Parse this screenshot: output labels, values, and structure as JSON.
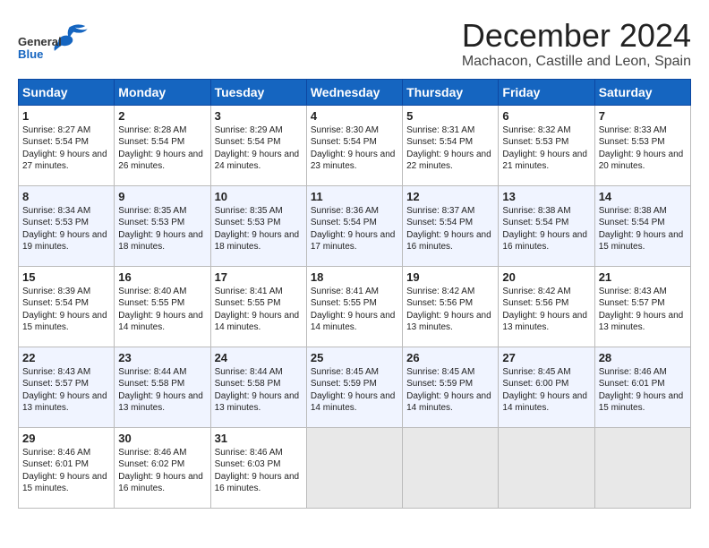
{
  "header": {
    "logo_general": "General",
    "logo_blue": "Blue",
    "month_title": "December 2024",
    "location": "Machacon, Castille and Leon, Spain"
  },
  "weekdays": [
    "Sunday",
    "Monday",
    "Tuesday",
    "Wednesday",
    "Thursday",
    "Friday",
    "Saturday"
  ],
  "weeks": [
    [
      {
        "day": "1",
        "sunrise": "Sunrise: 8:27 AM",
        "sunset": "Sunset: 5:54 PM",
        "daylight": "Daylight: 9 hours and 27 minutes."
      },
      {
        "day": "2",
        "sunrise": "Sunrise: 8:28 AM",
        "sunset": "Sunset: 5:54 PM",
        "daylight": "Daylight: 9 hours and 26 minutes."
      },
      {
        "day": "3",
        "sunrise": "Sunrise: 8:29 AM",
        "sunset": "Sunset: 5:54 PM",
        "daylight": "Daylight: 9 hours and 24 minutes."
      },
      {
        "day": "4",
        "sunrise": "Sunrise: 8:30 AM",
        "sunset": "Sunset: 5:54 PM",
        "daylight": "Daylight: 9 hours and 23 minutes."
      },
      {
        "day": "5",
        "sunrise": "Sunrise: 8:31 AM",
        "sunset": "Sunset: 5:54 PM",
        "daylight": "Daylight: 9 hours and 22 minutes."
      },
      {
        "day": "6",
        "sunrise": "Sunrise: 8:32 AM",
        "sunset": "Sunset: 5:53 PM",
        "daylight": "Daylight: 9 hours and 21 minutes."
      },
      {
        "day": "7",
        "sunrise": "Sunrise: 8:33 AM",
        "sunset": "Sunset: 5:53 PM",
        "daylight": "Daylight: 9 hours and 20 minutes."
      }
    ],
    [
      {
        "day": "8",
        "sunrise": "Sunrise: 8:34 AM",
        "sunset": "Sunset: 5:53 PM",
        "daylight": "Daylight: 9 hours and 19 minutes."
      },
      {
        "day": "9",
        "sunrise": "Sunrise: 8:35 AM",
        "sunset": "Sunset: 5:53 PM",
        "daylight": "Daylight: 9 hours and 18 minutes."
      },
      {
        "day": "10",
        "sunrise": "Sunrise: 8:35 AM",
        "sunset": "Sunset: 5:53 PM",
        "daylight": "Daylight: 9 hours and 18 minutes."
      },
      {
        "day": "11",
        "sunrise": "Sunrise: 8:36 AM",
        "sunset": "Sunset: 5:54 PM",
        "daylight": "Daylight: 9 hours and 17 minutes."
      },
      {
        "day": "12",
        "sunrise": "Sunrise: 8:37 AM",
        "sunset": "Sunset: 5:54 PM",
        "daylight": "Daylight: 9 hours and 16 minutes."
      },
      {
        "day": "13",
        "sunrise": "Sunrise: 8:38 AM",
        "sunset": "Sunset: 5:54 PM",
        "daylight": "Daylight: 9 hours and 16 minutes."
      },
      {
        "day": "14",
        "sunrise": "Sunrise: 8:38 AM",
        "sunset": "Sunset: 5:54 PM",
        "daylight": "Daylight: 9 hours and 15 minutes."
      }
    ],
    [
      {
        "day": "15",
        "sunrise": "Sunrise: 8:39 AM",
        "sunset": "Sunset: 5:54 PM",
        "daylight": "Daylight: 9 hours and 15 minutes."
      },
      {
        "day": "16",
        "sunrise": "Sunrise: 8:40 AM",
        "sunset": "Sunset: 5:55 PM",
        "daylight": "Daylight: 9 hours and 14 minutes."
      },
      {
        "day": "17",
        "sunrise": "Sunrise: 8:41 AM",
        "sunset": "Sunset: 5:55 PM",
        "daylight": "Daylight: 9 hours and 14 minutes."
      },
      {
        "day": "18",
        "sunrise": "Sunrise: 8:41 AM",
        "sunset": "Sunset: 5:55 PM",
        "daylight": "Daylight: 9 hours and 14 minutes."
      },
      {
        "day": "19",
        "sunrise": "Sunrise: 8:42 AM",
        "sunset": "Sunset: 5:56 PM",
        "daylight": "Daylight: 9 hours and 13 minutes."
      },
      {
        "day": "20",
        "sunrise": "Sunrise: 8:42 AM",
        "sunset": "Sunset: 5:56 PM",
        "daylight": "Daylight: 9 hours and 13 minutes."
      },
      {
        "day": "21",
        "sunrise": "Sunrise: 8:43 AM",
        "sunset": "Sunset: 5:57 PM",
        "daylight": "Daylight: 9 hours and 13 minutes."
      }
    ],
    [
      {
        "day": "22",
        "sunrise": "Sunrise: 8:43 AM",
        "sunset": "Sunset: 5:57 PM",
        "daylight": "Daylight: 9 hours and 13 minutes."
      },
      {
        "day": "23",
        "sunrise": "Sunrise: 8:44 AM",
        "sunset": "Sunset: 5:58 PM",
        "daylight": "Daylight: 9 hours and 13 minutes."
      },
      {
        "day": "24",
        "sunrise": "Sunrise: 8:44 AM",
        "sunset": "Sunset: 5:58 PM",
        "daylight": "Daylight: 9 hours and 13 minutes."
      },
      {
        "day": "25",
        "sunrise": "Sunrise: 8:45 AM",
        "sunset": "Sunset: 5:59 PM",
        "daylight": "Daylight: 9 hours and 14 minutes."
      },
      {
        "day": "26",
        "sunrise": "Sunrise: 8:45 AM",
        "sunset": "Sunset: 5:59 PM",
        "daylight": "Daylight: 9 hours and 14 minutes."
      },
      {
        "day": "27",
        "sunrise": "Sunrise: 8:45 AM",
        "sunset": "Sunset: 6:00 PM",
        "daylight": "Daylight: 9 hours and 14 minutes."
      },
      {
        "day": "28",
        "sunrise": "Sunrise: 8:46 AM",
        "sunset": "Sunset: 6:01 PM",
        "daylight": "Daylight: 9 hours and 15 minutes."
      }
    ],
    [
      {
        "day": "29",
        "sunrise": "Sunrise: 8:46 AM",
        "sunset": "Sunset: 6:01 PM",
        "daylight": "Daylight: 9 hours and 15 minutes."
      },
      {
        "day": "30",
        "sunrise": "Sunrise: 8:46 AM",
        "sunset": "Sunset: 6:02 PM",
        "daylight": "Daylight: 9 hours and 16 minutes."
      },
      {
        "day": "31",
        "sunrise": "Sunrise: 8:46 AM",
        "sunset": "Sunset: 6:03 PM",
        "daylight": "Daylight: 9 hours and 16 minutes."
      },
      null,
      null,
      null,
      null
    ]
  ]
}
